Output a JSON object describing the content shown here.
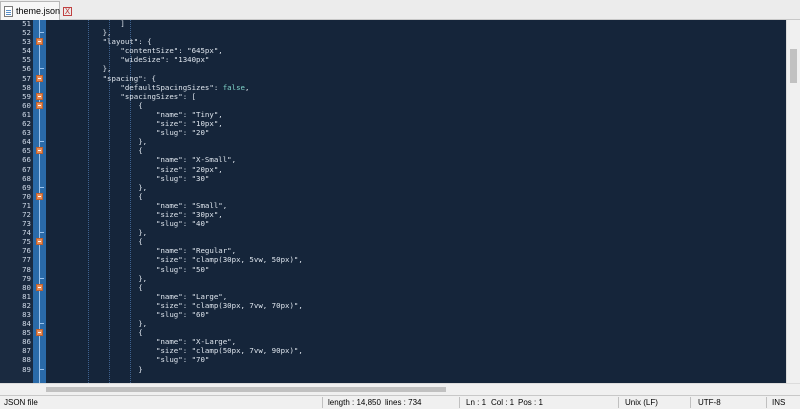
{
  "tab": {
    "label": "theme.json",
    "close": "X"
  },
  "editor": {
    "lines": [
      {
        "n": "51",
        "fold": "",
        "t": "            ]"
      },
      {
        "n": "52",
        "fold": "end",
        "t": "        },"
      },
      {
        "n": "53",
        "fold": "box",
        "t": "        \"layout\": {"
      },
      {
        "n": "54",
        "fold": "",
        "t": "            \"contentSize\": \"645px\","
      },
      {
        "n": "55",
        "fold": "",
        "t": "            \"wideSize\": \"1340px\""
      },
      {
        "n": "56",
        "fold": "end",
        "t": "        },"
      },
      {
        "n": "57",
        "fold": "box",
        "t": "        \"spacing\": {"
      },
      {
        "n": "58",
        "fold": "",
        "t": "            \"defaultSpacingSizes\": false,"
      },
      {
        "n": "59",
        "fold": "box",
        "t": "            \"spacingSizes\": ["
      },
      {
        "n": "60",
        "fold": "box",
        "t": "                {"
      },
      {
        "n": "61",
        "fold": "",
        "t": "                    \"name\": \"Tiny\","
      },
      {
        "n": "62",
        "fold": "",
        "t": "                    \"size\": \"10px\","
      },
      {
        "n": "63",
        "fold": "",
        "t": "                    \"slug\": \"20\""
      },
      {
        "n": "64",
        "fold": "end",
        "t": "                },"
      },
      {
        "n": "65",
        "fold": "box",
        "t": "                {"
      },
      {
        "n": "66",
        "fold": "",
        "t": "                    \"name\": \"X-Small\","
      },
      {
        "n": "67",
        "fold": "",
        "t": "                    \"size\": \"20px\","
      },
      {
        "n": "68",
        "fold": "",
        "t": "                    \"slug\": \"30\""
      },
      {
        "n": "69",
        "fold": "end",
        "t": "                },"
      },
      {
        "n": "70",
        "fold": "box",
        "t": "                {"
      },
      {
        "n": "71",
        "fold": "",
        "t": "                    \"name\": \"Small\","
      },
      {
        "n": "72",
        "fold": "",
        "t": "                    \"size\": \"30px\","
      },
      {
        "n": "73",
        "fold": "",
        "t": "                    \"slug\": \"40\""
      },
      {
        "n": "74",
        "fold": "end",
        "t": "                },"
      },
      {
        "n": "75",
        "fold": "box",
        "t": "                {"
      },
      {
        "n": "76",
        "fold": "",
        "t": "                    \"name\": \"Regular\","
      },
      {
        "n": "77",
        "fold": "",
        "t": "                    \"size\": \"clamp(30px, 5vw, 50px)\","
      },
      {
        "n": "78",
        "fold": "",
        "t": "                    \"slug\": \"50\""
      },
      {
        "n": "79",
        "fold": "end",
        "t": "                },"
      },
      {
        "n": "80",
        "fold": "box",
        "t": "                {"
      },
      {
        "n": "81",
        "fold": "",
        "t": "                    \"name\": \"Large\","
      },
      {
        "n": "82",
        "fold": "",
        "t": "                    \"size\": \"clamp(30px, 7vw, 70px)\","
      },
      {
        "n": "83",
        "fold": "",
        "t": "                    \"slug\": \"60\""
      },
      {
        "n": "84",
        "fold": "end",
        "t": "                },"
      },
      {
        "n": "85",
        "fold": "box",
        "t": "                {"
      },
      {
        "n": "86",
        "fold": "",
        "t": "                    \"name\": \"X-Large\","
      },
      {
        "n": "87",
        "fold": "",
        "t": "                    \"size\": \"clamp(50px, 7vw, 90px)\","
      },
      {
        "n": "88",
        "fold": "",
        "t": "                    \"slug\": \"70\""
      },
      {
        "n": "89",
        "fold": "end",
        "t": "                }"
      }
    ]
  },
  "status": {
    "file_type": "JSON file",
    "length": "length : 14,850",
    "lines": "lines : 734",
    "ln": "Ln : 1",
    "col": "Col : 1",
    "pos": "Pos : 1",
    "eol": "Unix (LF)",
    "encoding": "UTF-8",
    "mode": "INS"
  },
  "colors": {
    "editor_bg": "#15253a",
    "fold_margin": "#2a6aa8",
    "fold_marker": "#e88b55",
    "keyword": "#7fd3c8"
  }
}
